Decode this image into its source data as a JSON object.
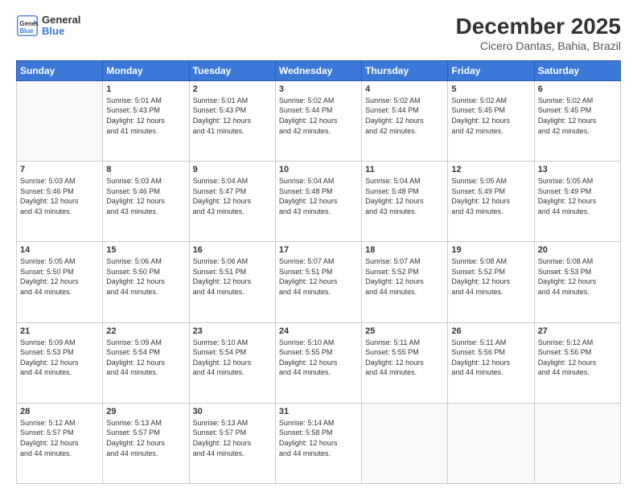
{
  "logo": {
    "line1": "General",
    "line2": "Blue"
  },
  "title": "December 2025",
  "subtitle": "Cicero Dantas, Bahia, Brazil",
  "days_of_week": [
    "Sunday",
    "Monday",
    "Tuesday",
    "Wednesday",
    "Thursday",
    "Friday",
    "Saturday"
  ],
  "weeks": [
    [
      {
        "day": "",
        "info": ""
      },
      {
        "day": "1",
        "info": "Sunrise: 5:01 AM\nSunset: 5:43 PM\nDaylight: 12 hours\nand 41 minutes."
      },
      {
        "day": "2",
        "info": "Sunrise: 5:01 AM\nSunset: 5:43 PM\nDaylight: 12 hours\nand 41 minutes."
      },
      {
        "day": "3",
        "info": "Sunrise: 5:02 AM\nSunset: 5:44 PM\nDaylight: 12 hours\nand 42 minutes."
      },
      {
        "day": "4",
        "info": "Sunrise: 5:02 AM\nSunset: 5:44 PM\nDaylight: 12 hours\nand 42 minutes."
      },
      {
        "day": "5",
        "info": "Sunrise: 5:02 AM\nSunset: 5:45 PM\nDaylight: 12 hours\nand 42 minutes."
      },
      {
        "day": "6",
        "info": "Sunrise: 5:02 AM\nSunset: 5:45 PM\nDaylight: 12 hours\nand 42 minutes."
      }
    ],
    [
      {
        "day": "7",
        "info": "Sunrise: 5:03 AM\nSunset: 5:46 PM\nDaylight: 12 hours\nand 43 minutes."
      },
      {
        "day": "8",
        "info": "Sunrise: 5:03 AM\nSunset: 5:46 PM\nDaylight: 12 hours\nand 43 minutes."
      },
      {
        "day": "9",
        "info": "Sunrise: 5:04 AM\nSunset: 5:47 PM\nDaylight: 12 hours\nand 43 minutes."
      },
      {
        "day": "10",
        "info": "Sunrise: 5:04 AM\nSunset: 5:48 PM\nDaylight: 12 hours\nand 43 minutes."
      },
      {
        "day": "11",
        "info": "Sunrise: 5:04 AM\nSunset: 5:48 PM\nDaylight: 12 hours\nand 43 minutes."
      },
      {
        "day": "12",
        "info": "Sunrise: 5:05 AM\nSunset: 5:49 PM\nDaylight: 12 hours\nand 43 minutes."
      },
      {
        "day": "13",
        "info": "Sunrise: 5:05 AM\nSunset: 5:49 PM\nDaylight: 12 hours\nand 44 minutes."
      }
    ],
    [
      {
        "day": "14",
        "info": "Sunrise: 5:05 AM\nSunset: 5:50 PM\nDaylight: 12 hours\nand 44 minutes."
      },
      {
        "day": "15",
        "info": "Sunrise: 5:06 AM\nSunset: 5:50 PM\nDaylight: 12 hours\nand 44 minutes."
      },
      {
        "day": "16",
        "info": "Sunrise: 5:06 AM\nSunset: 5:51 PM\nDaylight: 12 hours\nand 44 minutes."
      },
      {
        "day": "17",
        "info": "Sunrise: 5:07 AM\nSunset: 5:51 PM\nDaylight: 12 hours\nand 44 minutes."
      },
      {
        "day": "18",
        "info": "Sunrise: 5:07 AM\nSunset: 5:52 PM\nDaylight: 12 hours\nand 44 minutes."
      },
      {
        "day": "19",
        "info": "Sunrise: 5:08 AM\nSunset: 5:52 PM\nDaylight: 12 hours\nand 44 minutes."
      },
      {
        "day": "20",
        "info": "Sunrise: 5:08 AM\nSunset: 5:53 PM\nDaylight: 12 hours\nand 44 minutes."
      }
    ],
    [
      {
        "day": "21",
        "info": "Sunrise: 5:09 AM\nSunset: 5:53 PM\nDaylight: 12 hours\nand 44 minutes."
      },
      {
        "day": "22",
        "info": "Sunrise: 5:09 AM\nSunset: 5:54 PM\nDaylight: 12 hours\nand 44 minutes."
      },
      {
        "day": "23",
        "info": "Sunrise: 5:10 AM\nSunset: 5:54 PM\nDaylight: 12 hours\nand 44 minutes."
      },
      {
        "day": "24",
        "info": "Sunrise: 5:10 AM\nSunset: 5:55 PM\nDaylight: 12 hours\nand 44 minutes."
      },
      {
        "day": "25",
        "info": "Sunrise: 5:11 AM\nSunset: 5:55 PM\nDaylight: 12 hours\nand 44 minutes."
      },
      {
        "day": "26",
        "info": "Sunrise: 5:11 AM\nSunset: 5:56 PM\nDaylight: 12 hours\nand 44 minutes."
      },
      {
        "day": "27",
        "info": "Sunrise: 5:12 AM\nSunset: 5:56 PM\nDaylight: 12 hours\nand 44 minutes."
      }
    ],
    [
      {
        "day": "28",
        "info": "Sunrise: 5:12 AM\nSunset: 5:57 PM\nDaylight: 12 hours\nand 44 minutes."
      },
      {
        "day": "29",
        "info": "Sunrise: 5:13 AM\nSunset: 5:57 PM\nDaylight: 12 hours\nand 44 minutes."
      },
      {
        "day": "30",
        "info": "Sunrise: 5:13 AM\nSunset: 5:57 PM\nDaylight: 12 hours\nand 44 minutes."
      },
      {
        "day": "31",
        "info": "Sunrise: 5:14 AM\nSunset: 5:58 PM\nDaylight: 12 hours\nand 44 minutes."
      },
      {
        "day": "",
        "info": ""
      },
      {
        "day": "",
        "info": ""
      },
      {
        "day": "",
        "info": ""
      }
    ]
  ]
}
